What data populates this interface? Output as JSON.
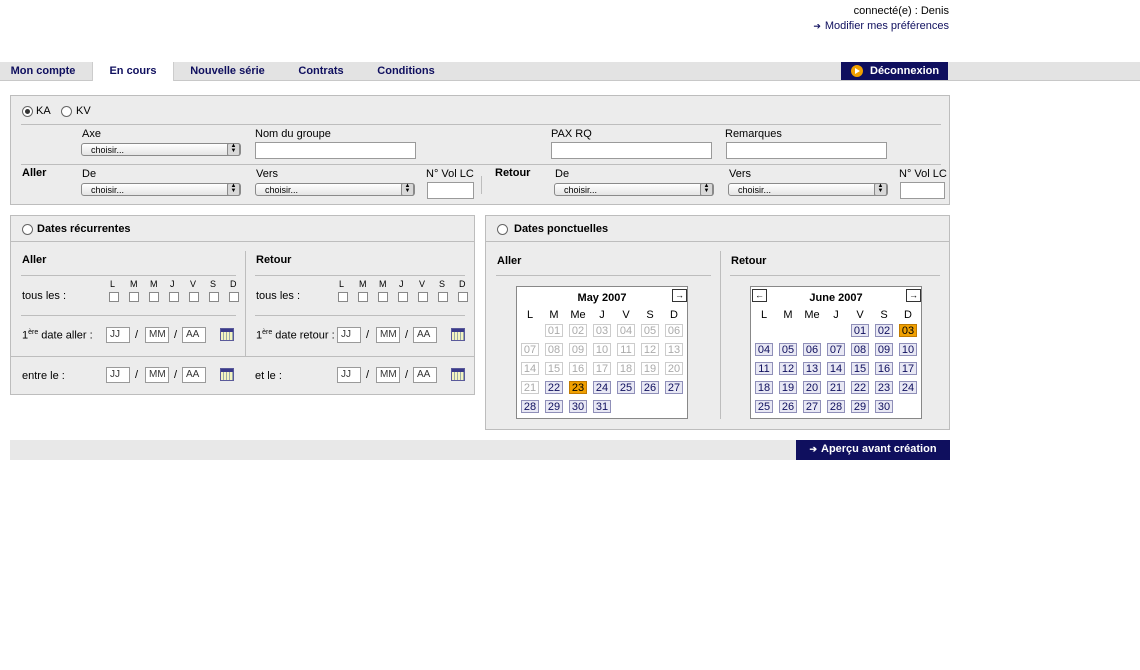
{
  "header": {
    "connected": "connecté(e) : Denis",
    "prefs": "Modifier mes préférences"
  },
  "tabs": [
    "Mon compte",
    "En cours",
    "Nouvelle série",
    "Contrats",
    "Conditions"
  ],
  "logout": "Déconnexion",
  "trip": {
    "options": [
      "KA",
      "KV"
    ],
    "axe": "Axe",
    "nom_groupe": "Nom du groupe",
    "pax": "PAX RQ",
    "remarques": "Remarques",
    "aller": "Aller",
    "retour": "Retour",
    "de": "De",
    "vers": "Vers",
    "vol": "N° Vol LC",
    "choose": "choisir..."
  },
  "recurrent": {
    "title": "Dates récurrentes",
    "aller": "Aller",
    "retour": "Retour",
    "days": [
      "L",
      "M",
      "M",
      "J",
      "V",
      "S",
      "D"
    ],
    "tous_les": "tous les :",
    "first_aller": "1ère date aller :",
    "first_retour": "1ère date retour :",
    "sup": "ère",
    "first_aller_rest": " date aller :",
    "first_retour_rest": " date retour :",
    "between": "entre le :",
    "and": "et le :",
    "jj": "JJ",
    "mm": "MM",
    "aa": "AA"
  },
  "punctual": {
    "title": "Dates ponctuelles",
    "aller": "Aller",
    "retour": "Retour",
    "dow": [
      "L",
      "M",
      "Me",
      "J",
      "V",
      "S",
      "D"
    ],
    "may": {
      "title": "May 2007"
    },
    "june": {
      "title": "June 2007"
    },
    "prev": "←",
    "next": "→"
  },
  "preview": "Aperçu avant création"
}
